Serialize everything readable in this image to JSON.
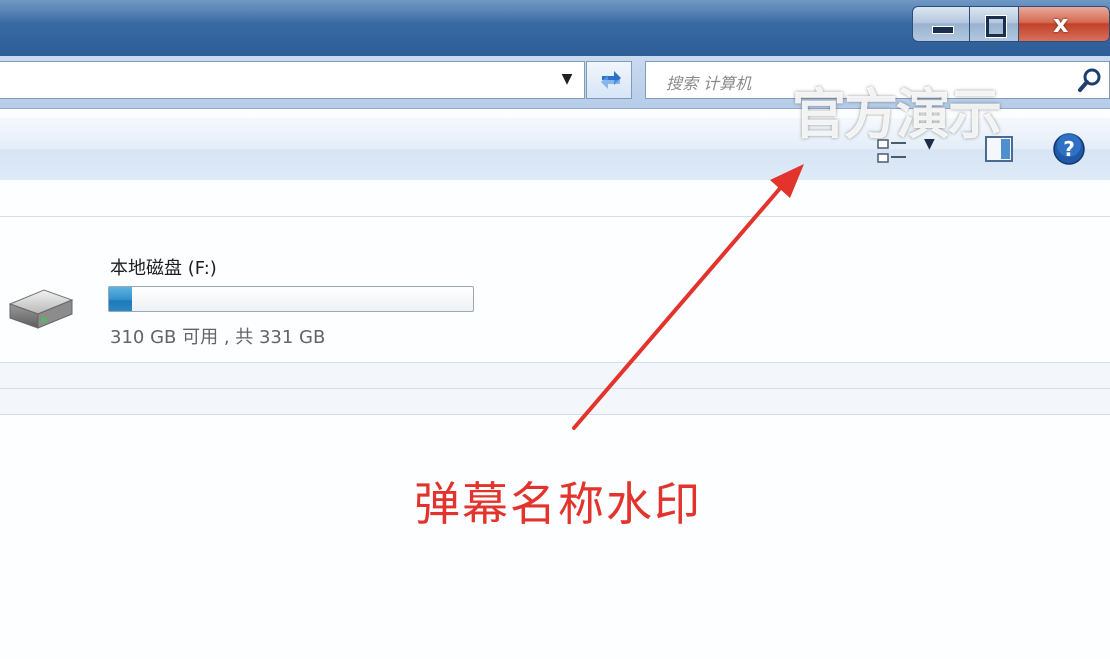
{
  "window": {
    "minimize_icon": "minimize-icon",
    "maximize_icon": "restore-icon",
    "close_label": "x"
  },
  "addressbar": {
    "dropdown_icon": "chevron-down-icon",
    "refresh_icon": "refresh-icon",
    "search_placeholder": "搜索 计算机",
    "search_icon": "search-icon"
  },
  "toolbar": {
    "view_icon": "change-view-icon",
    "view_dropdown_icon": "chevron-down-icon",
    "pane_icon": "preview-pane-icon",
    "help_icon": "help-icon"
  },
  "drives": [
    {
      "label": "本地磁盘 (F:)",
      "space_text": "310 GB 可用 , 共 331 GB",
      "used_fraction": 0.0634,
      "icon": "hard-drive-icon"
    }
  ],
  "overlay": {
    "watermark": "官方演示",
    "annotation": "弹幕名称水印",
    "annotation_color": "#e2342c"
  },
  "colors": {
    "titlebar": "#3a6aa3",
    "close_button": "#c2412a",
    "bar_fill": "#2f8fcb"
  }
}
